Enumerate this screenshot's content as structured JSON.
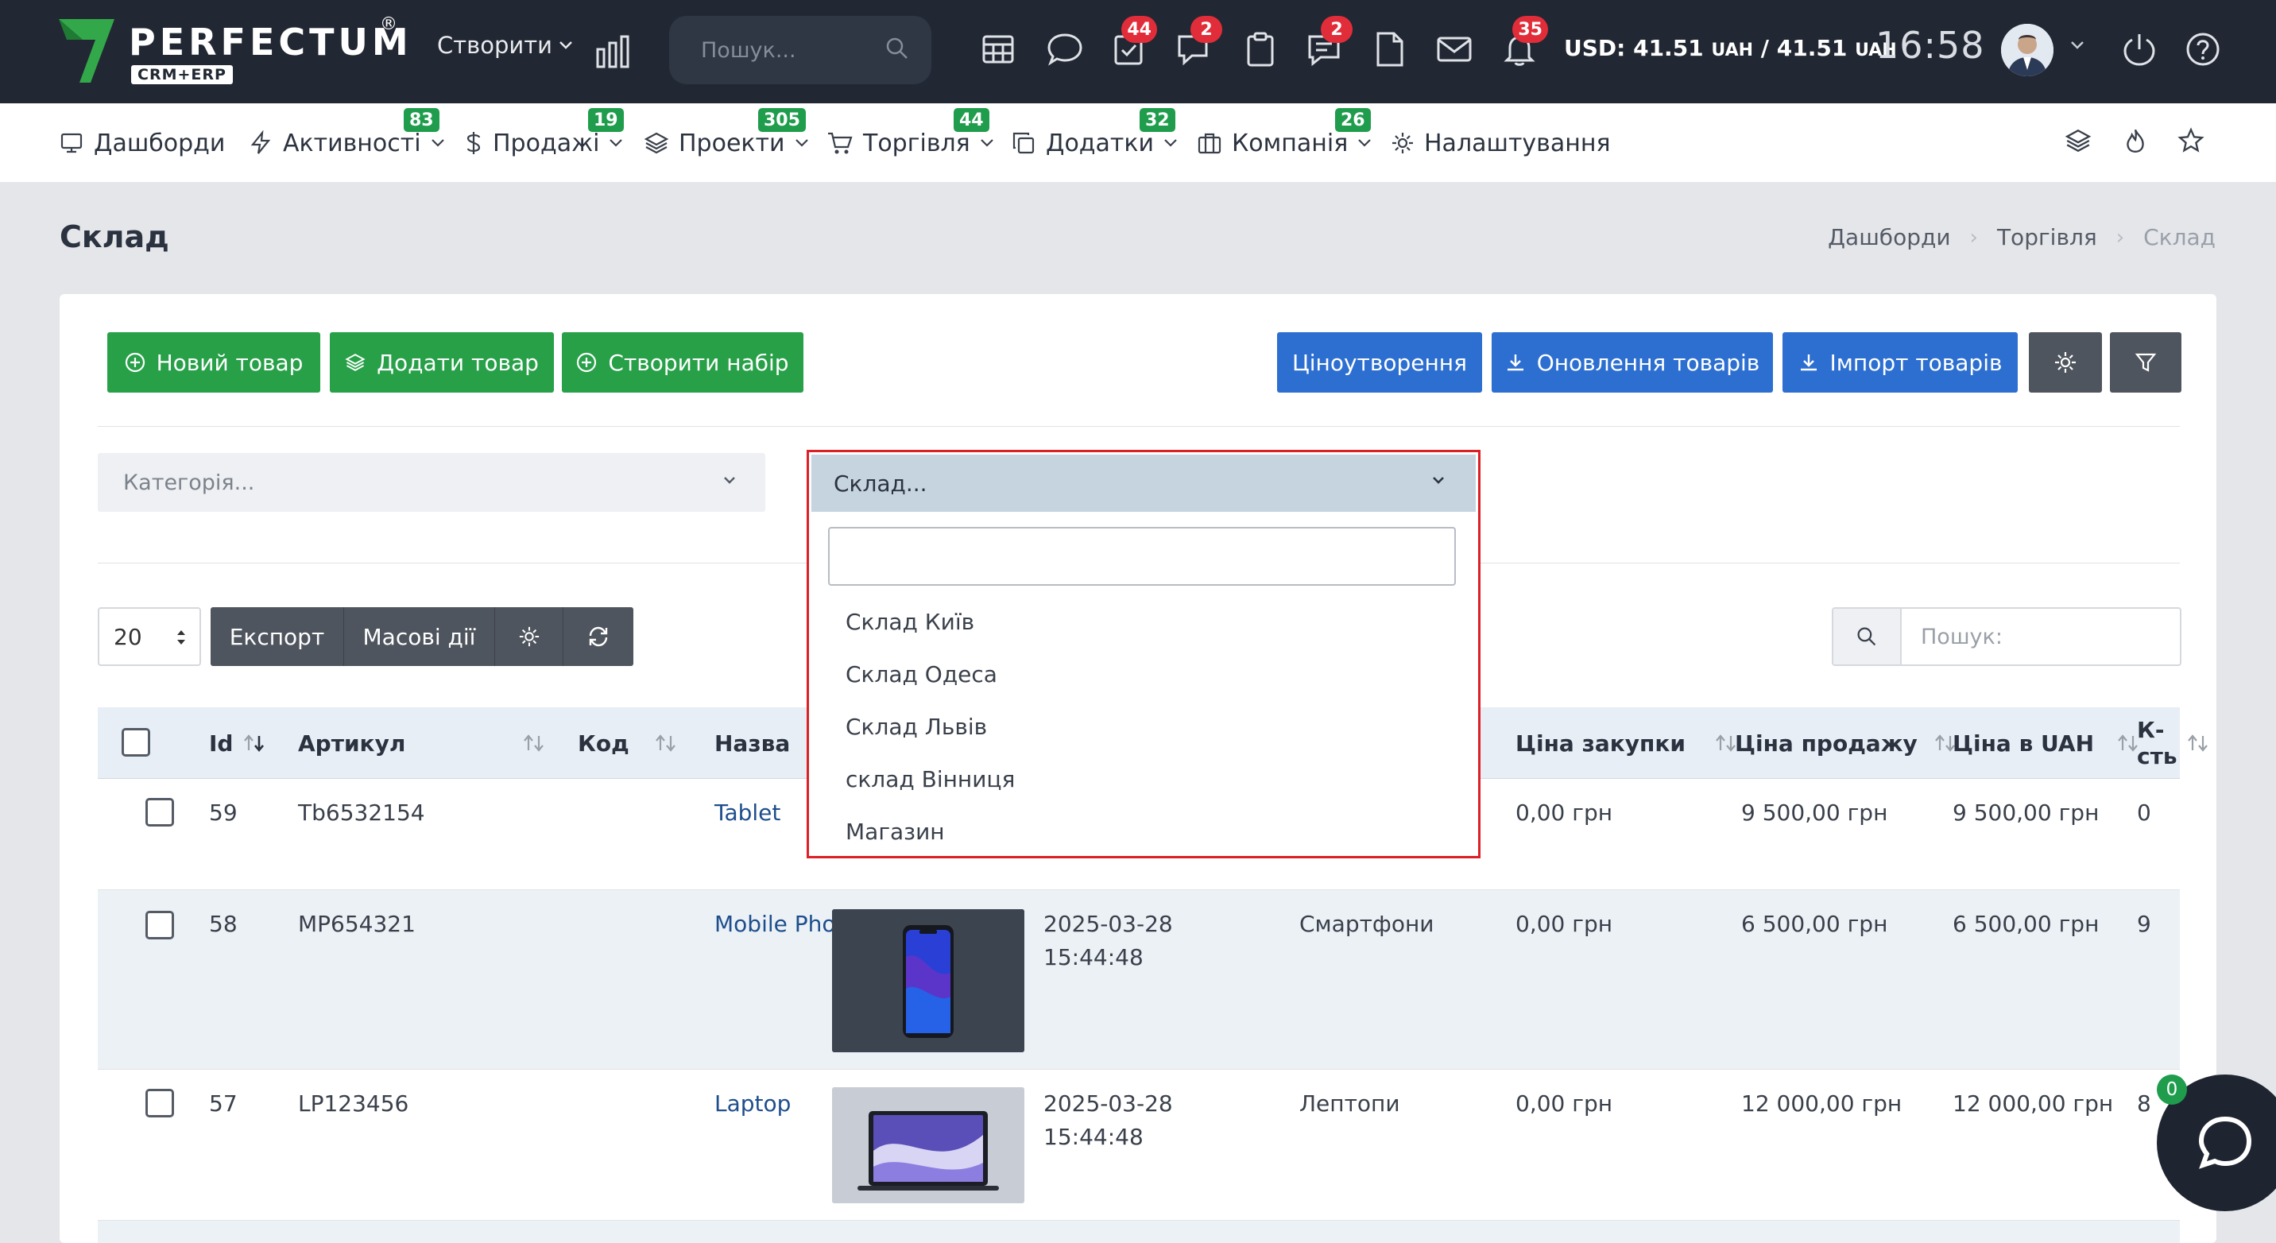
{
  "app": {
    "logo_name": "PERFECTUM",
    "logo_reg": "®",
    "logo_sub": "CRM+ERP",
    "create_label": "Створити",
    "search_placeholder": "Пошук...",
    "badges": {
      "tasks": "44",
      "chat": "2",
      "notes": "2",
      "notifications": "35"
    },
    "currency_usd": "USD: 41.51",
    "currency_unit_1": "UAH",
    "currency_sep": "/ 41.51",
    "currency_unit_2": "UAH",
    "clock": "16:58"
  },
  "nav": {
    "items": [
      {
        "label": "Дашборди"
      },
      {
        "label": "Активності",
        "badge": "83"
      },
      {
        "label": "Продажі",
        "badge": "19"
      },
      {
        "label": "Проекти",
        "badge": "305"
      },
      {
        "label": "Торгівля",
        "badge": "44"
      },
      {
        "label": "Додатки",
        "badge": "32"
      },
      {
        "label": "Компанія",
        "badge": "26"
      },
      {
        "label": "Налаштування"
      }
    ]
  },
  "page": {
    "title": "Склад",
    "breadcrumb": [
      "Дашборди",
      "Торгівля",
      "Склад"
    ]
  },
  "toolbar": {
    "new_product": "Новий товар",
    "add_product": "Додати товар",
    "create_set": "Створити набір",
    "pricing": "Ціноутворення",
    "update_products": "Оновлення товарів",
    "import_products": "Імпорт товарів"
  },
  "filters": {
    "category_placeholder": "Категорія...",
    "warehouse_placeholder": "Склад...",
    "warehouse_options": [
      "Склад Київ",
      "Склад Одеса",
      "Склад Львів",
      "склад Вінниця",
      "Магазин"
    ]
  },
  "table_controls": {
    "page_length": "20",
    "export": "Експорт",
    "bulk": "Масові дії",
    "search_placeholder": "Пошук:"
  },
  "table": {
    "columns": [
      "Id",
      "Артикул",
      "Код",
      "Назва",
      "Ціна закупки",
      "Ціна продажу",
      "Ціна в UAH",
      "К-сть"
    ],
    "rows": [
      {
        "id": "59",
        "sku": "Tb6532154",
        "code": "",
        "name": "Tablet",
        "date": "",
        "time": "",
        "category": "",
        "purchase": "0,00 грн",
        "sale": "9 500,00 грн",
        "uah": "9 500,00 грн",
        "qty": "0"
      },
      {
        "id": "58",
        "sku": "MP654321",
        "code": "",
        "name": "Mobile Phone",
        "date": "2025-03-28",
        "time": "15:44:48",
        "category": "Смартфони",
        "purchase": "0,00 грн",
        "sale": "6 500,00 грн",
        "uah": "6 500,00 грн",
        "qty": "9"
      },
      {
        "id": "57",
        "sku": "LP123456",
        "code": "",
        "name": "Laptop",
        "date": "2025-03-28",
        "time": "15:44:48",
        "category": "Лептопи",
        "purchase": "0,00 грн",
        "sale": "12 000,00 грн",
        "uah": "12 000,00 грн",
        "qty": "8"
      }
    ]
  },
  "chat": {
    "badge": "0"
  },
  "colors": {
    "topbar": "#222833",
    "green": "#27a048",
    "blue": "#2d6fd0",
    "gray": "#4f555e",
    "highlight": "#dd1f26",
    "badge_red": "#e12d39"
  }
}
